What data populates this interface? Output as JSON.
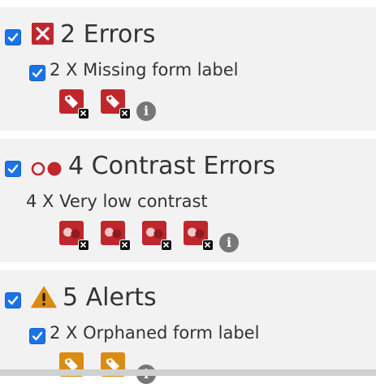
{
  "colors": {
    "panel_bg": "#f2f2f3",
    "checkbox": "#1a73e8",
    "error_red": "#c0272d",
    "alert_orange": "#d98c12",
    "info_gray": "#777777",
    "text": "#333333"
  },
  "sections": [
    {
      "key": "errors",
      "checked": true,
      "icon": "error-x-icon",
      "title": "2 Errors",
      "items": [
        {
          "checked": true,
          "label": "2 X Missing form label",
          "issue_icons": [
            "error-tag-icon",
            "error-tag-icon"
          ],
          "count": 2
        }
      ]
    },
    {
      "key": "contrast",
      "checked": true,
      "icon": "contrast-icon",
      "title": "4 Contrast Errors",
      "items": [
        {
          "checked": false,
          "label": "4 X Very low contrast",
          "issue_icons": [
            "contrast-error-icon",
            "contrast-error-icon",
            "contrast-error-icon",
            "contrast-error-icon"
          ],
          "count": 4
        }
      ]
    },
    {
      "key": "alerts",
      "checked": true,
      "icon": "alert-triangle-icon",
      "title": "5 Alerts",
      "items": [
        {
          "checked": true,
          "label": "2 X Orphaned form label",
          "issue_icons": [
            "alert-tag-icon",
            "alert-tag-icon"
          ],
          "count": 2
        }
      ]
    }
  ],
  "info_icon": "i"
}
